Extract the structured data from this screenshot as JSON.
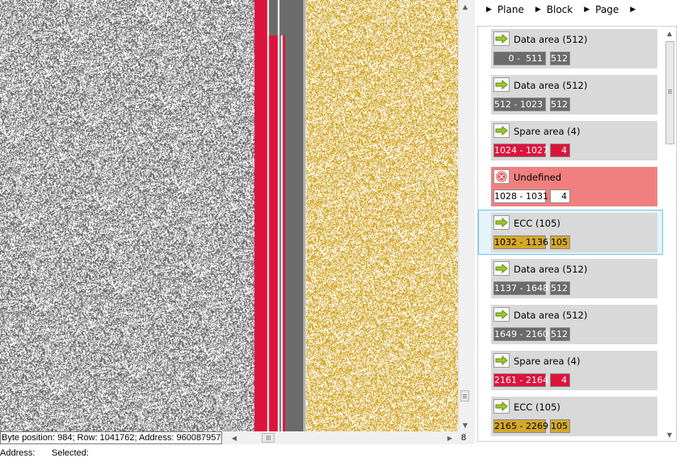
{
  "viz": {
    "colors": {
      "gray": "#6b6b6b",
      "red": "#dc143c",
      "gold": "#d4a82a",
      "white": "#ffffff"
    }
  },
  "viz_scrollbar": {
    "up_icon": "triangle-up-icon",
    "down_icon": "triangle-down-icon"
  },
  "status_bar": {
    "byte_position": "Byte position: 984; Row: 1041762; Address: 960087957",
    "column_count": "8",
    "address_label": "Address:",
    "selected_label": "Selected:"
  },
  "breadcrumb": [
    "Plane",
    "Block",
    "Page"
  ],
  "items": [
    {
      "type": "data",
      "label": "Data area (512)",
      "range": "  0 -  511",
      "size": "512",
      "icon": "arrow-right-icon",
      "color": "#6b6b6b",
      "text_color": "#ffffff"
    },
    {
      "type": "data",
      "label": "Data area (512)",
      "range": "512 - 1023",
      "size": "512",
      "icon": "arrow-right-icon",
      "color": "#6b6b6b",
      "text_color": "#ffffff"
    },
    {
      "type": "spare",
      "label": "Spare area (4)",
      "range": "1024 - 1027",
      "size": "4",
      "icon": "arrow-right-icon",
      "color": "#dc143c",
      "text_color": "#ffffff"
    },
    {
      "type": "undefined",
      "label": "Undefined",
      "range": "1028 - 1031",
      "size": "4",
      "icon": "error-circle-icon",
      "color": "#ffffff",
      "text_color": "#000000"
    },
    {
      "type": "ecc",
      "label": "ECC (105)",
      "range": "1032 - 1136",
      "size": "105",
      "icon": "arrow-right-icon",
      "color": "#d4a82a",
      "text_color": "#000000",
      "selected": true
    },
    {
      "type": "data",
      "label": "Data area (512)",
      "range": "1137 - 1648",
      "size": "512",
      "icon": "arrow-right-icon",
      "color": "#6b6b6b",
      "text_color": "#ffffff"
    },
    {
      "type": "data",
      "label": "Data area (512)",
      "range": "1649 - 2160",
      "size": "512",
      "icon": "arrow-right-icon",
      "color": "#6b6b6b",
      "text_color": "#ffffff"
    },
    {
      "type": "spare",
      "label": "Spare area (4)",
      "range": "2161 - 2164",
      "size": "4",
      "icon": "arrow-right-icon",
      "color": "#dc143c",
      "text_color": "#ffffff"
    },
    {
      "type": "ecc",
      "label": "ECC (105)",
      "range": "2165 - 2269",
      "size": "105",
      "icon": "arrow-right-icon",
      "color": "#d4a82a",
      "text_color": "#000000"
    }
  ]
}
